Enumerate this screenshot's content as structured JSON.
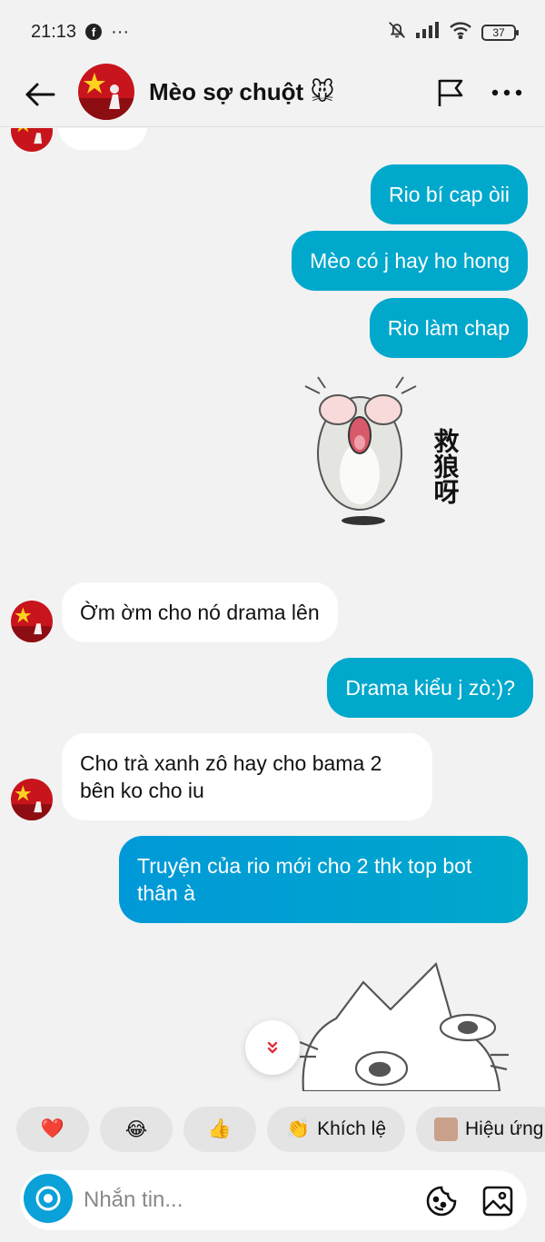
{
  "status_bar": {
    "time": "21:13",
    "facebook_glyph": "f",
    "overflow": "···",
    "battery": "37"
  },
  "header": {
    "contact_name": "Mèo sợ chuột 🐭",
    "back_icon": "arrow-left-icon",
    "flag_icon": "flag-icon",
    "more_icon": "more-horizontal-icon"
  },
  "messages": [
    {
      "direction": "out",
      "text": "Rio bí cap òii"
    },
    {
      "direction": "out",
      "text": "Mèo có j hay ho hong"
    },
    {
      "direction": "out",
      "text": "Rio làm chap"
    },
    {
      "direction": "out",
      "type": "sticker",
      "caption": "救狼呀"
    },
    {
      "direction": "in",
      "text": "Ờm ờm cho nó drama lên"
    },
    {
      "direction": "out",
      "text": "Drama kiểu j zò:)?"
    },
    {
      "direction": "in",
      "text": "Cho trà xanh zô hay cho bama 2 bên ko cho iu"
    },
    {
      "direction": "out",
      "text": "Truyện của rio mới cho 2 thk top bot thân à"
    },
    {
      "direction": "out",
      "type": "sticker"
    }
  ],
  "reactions": [
    {
      "emoji": "❤️",
      "label": ""
    },
    {
      "emoji": "😂",
      "label": ""
    },
    {
      "emoji": "👍",
      "label": ""
    },
    {
      "emoji": "👏",
      "label": "Khích lệ"
    },
    {
      "emoji": "",
      "label": "Hiệu ứng"
    }
  ],
  "composer": {
    "placeholder": "Nhắn tin..."
  },
  "colors": {
    "outgoing_bubble": "#00a8cc",
    "incoming_bubble": "#ffffff",
    "background": "#f2f2f2",
    "accent": "#0aa0d8"
  }
}
